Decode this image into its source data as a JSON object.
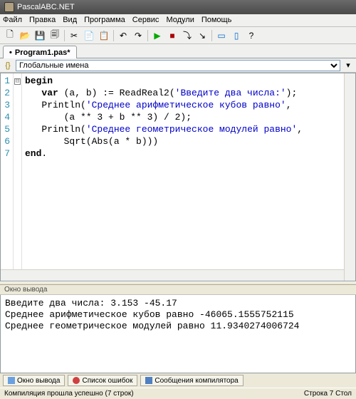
{
  "window": {
    "title": "PascalABC.NET"
  },
  "menu": {
    "file": "Файл",
    "edit": "Правка",
    "view": "Вид",
    "program": "Программа",
    "service": "Сервис",
    "modules": "Модули",
    "help": "Помощь"
  },
  "toolbar_icons": {
    "new": "🗋",
    "open": "📂",
    "save": "💾",
    "saveall": "🗐",
    "cut": "✂",
    "copy": "📄",
    "paste": "📋",
    "undo": "↶",
    "redo": "↷",
    "run": "▶",
    "stop": "■",
    "stepover": "⤵",
    "stepin": "↘",
    "win1": "▭",
    "win2": "▯",
    "help": "?"
  },
  "tab": {
    "name": "Program1.pas*",
    "marker": "•"
  },
  "nav": {
    "label": "Глобальные имена",
    "icon": "{}"
  },
  "code": {
    "lines": [
      "1",
      "2",
      "3",
      "4",
      "5",
      "6",
      "7"
    ],
    "fold": "⊟",
    "l1_begin": "begin",
    "l2_var": "var",
    "l2_decl": " (a, b) := ReadReal2(",
    "l2_str": "'Введите два числа:'",
    "l2_end": ");",
    "l3_fn": "   Println(",
    "l3_str": "'Среднее арифметическое кубов равно'",
    "l3_end": ",",
    "l4": "       (a ** 3 + b ** 3) / 2);",
    "l5_fn": "   Println(",
    "l5_str": "'Среднее геометрическое модулей равно'",
    "l5_end": ",",
    "l6": "       Sqrt(Abs(a * b)))",
    "l7_end": "end",
    "l7_dot": "."
  },
  "output": {
    "header": "Окно вывода",
    "line1": "Введите два числа: 3.153 -45.17",
    "line2": "Среднее арифметическое кубов равно -46065.1555752115",
    "line3": "Среднее геометрическое модулей равно 11.9340274006724"
  },
  "bottom_tabs": {
    "t1": "Окно вывода",
    "t2": "Список ошибок",
    "t3": "Сообщения компилятора"
  },
  "status": {
    "left": "Компиляция прошла успешно (7 строк)",
    "right": "Строка  7 Стол"
  }
}
